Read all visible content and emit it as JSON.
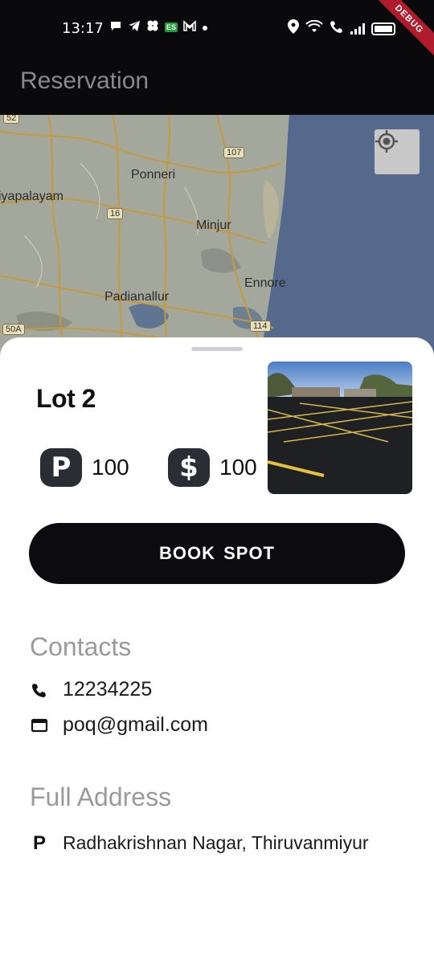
{
  "status_bar": {
    "time": "13:17",
    "debug_label": "DEBUG"
  },
  "app_bar": {
    "title": "Reservation"
  },
  "map": {
    "places": [
      "Ponneri",
      "iyapalayam",
      "Minjur",
      "Ennore",
      "Padianallur"
    ],
    "road_badges": [
      "52",
      "107",
      "16",
      "114",
      "50A"
    ],
    "locate_icon": "my-location-icon"
  },
  "lot": {
    "name": "Lot 2",
    "parking_icon_glyph": "P",
    "parking_value": "100",
    "price_icon_glyph": "$",
    "price_value": "100"
  },
  "actions": {
    "book_label": "BOOK SPOT"
  },
  "contacts": {
    "title": "Contacts",
    "phone": "12234225",
    "email": "poq@gmail.com"
  },
  "address": {
    "title": "Full Address",
    "icon_glyph": "P",
    "text": "Radhakrishnan Nagar, Thiruvanmiyur"
  },
  "colors": {
    "app_bar": "#0a0a0c",
    "button": "#0b0b10",
    "section_title": "#9a9a9a"
  }
}
